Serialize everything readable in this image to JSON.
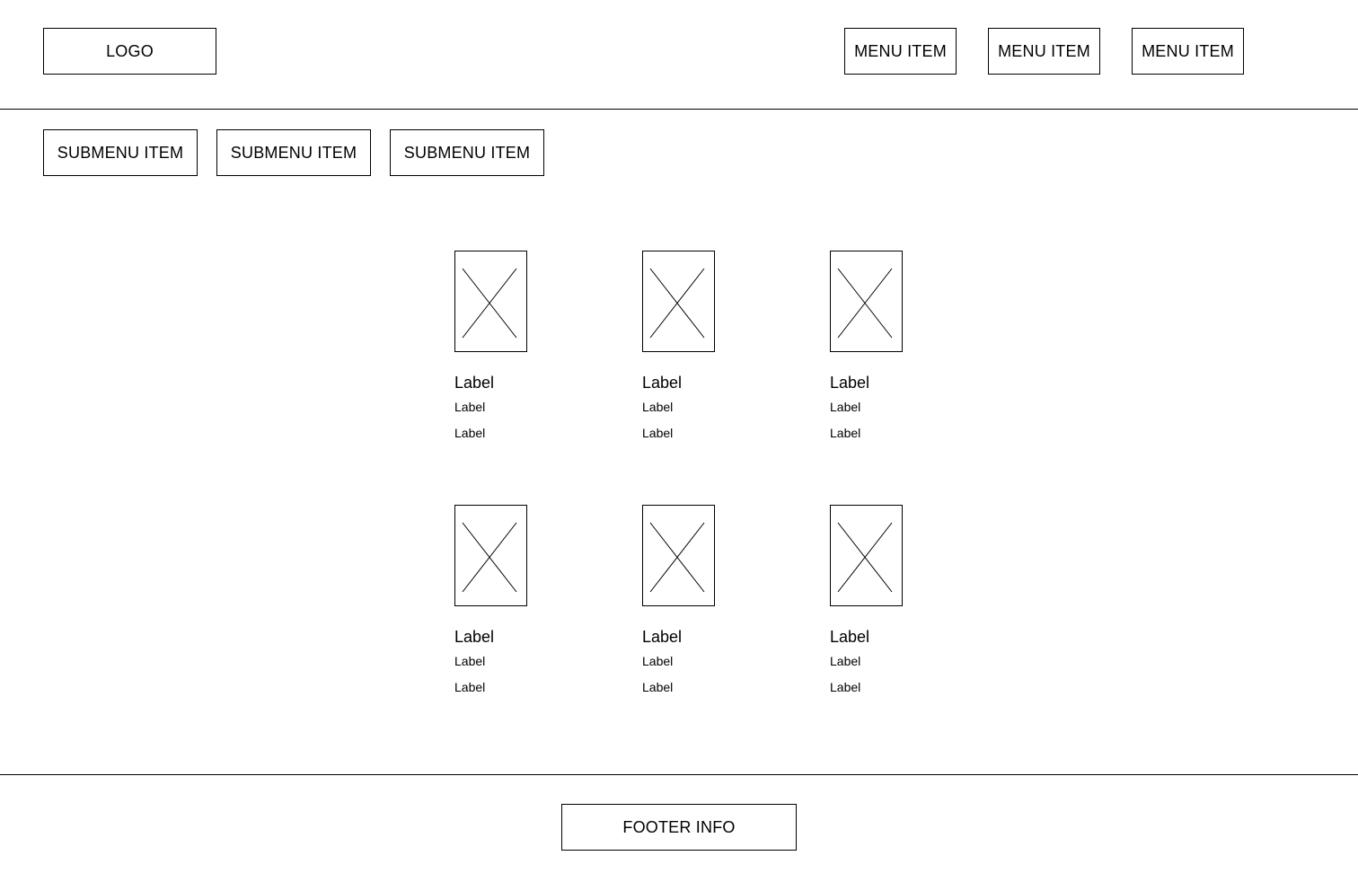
{
  "header": {
    "logo": "LOGO",
    "menu": [
      "MENU ITEM",
      "MENU ITEM",
      "MENU ITEM"
    ]
  },
  "submenu": [
    "SUBMENU ITEM",
    "SUBMENU ITEM",
    "SUBMENU ITEM"
  ],
  "products": [
    {
      "title": "Label",
      "line1": "Label",
      "line2": "Label"
    },
    {
      "title": "Label",
      "line1": "Label",
      "line2": "Label"
    },
    {
      "title": "Label",
      "line1": "Label",
      "line2": "Label"
    },
    {
      "title": "Label",
      "line1": "Label",
      "line2": "Label"
    },
    {
      "title": "Label",
      "line1": "Label",
      "line2": "Label"
    },
    {
      "title": "Label",
      "line1": "Label",
      "line2": "Label"
    }
  ],
  "footer": {
    "info": "FOOTER INFO"
  },
  "icons": {
    "placeholder": "image-placeholder-icon"
  }
}
